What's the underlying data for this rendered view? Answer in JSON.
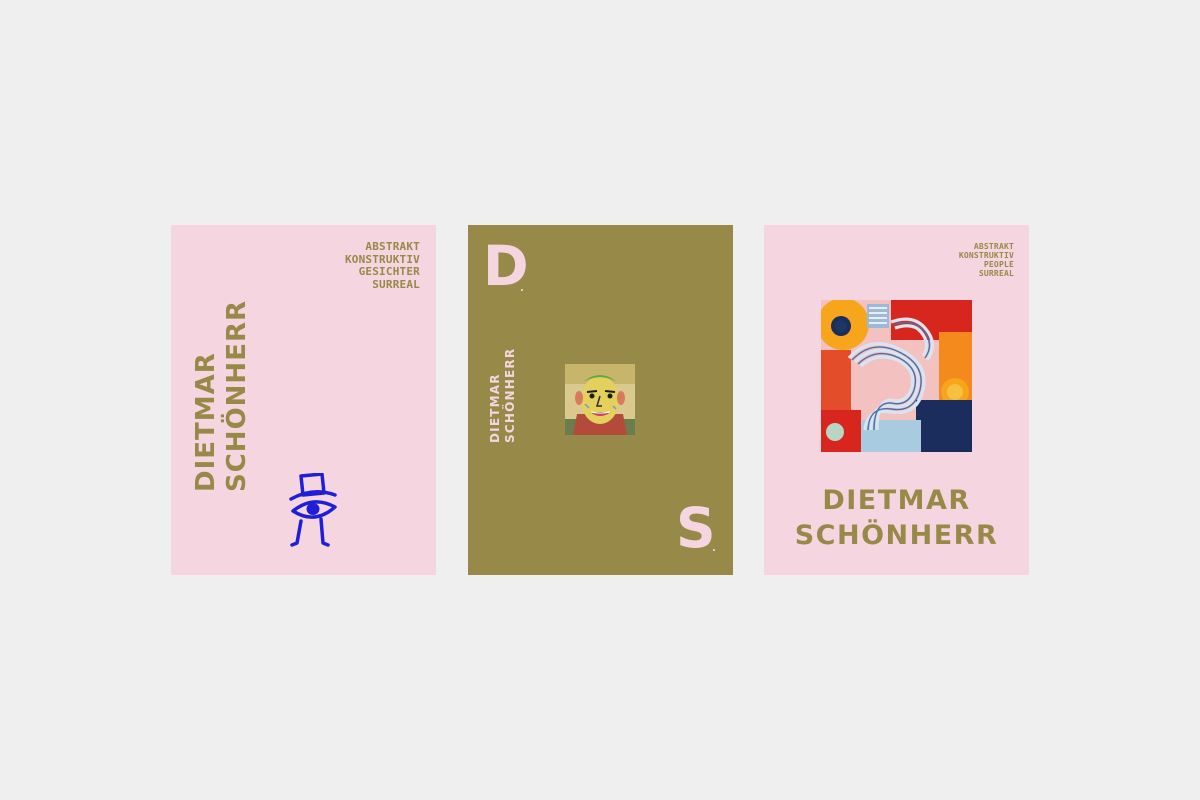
{
  "colors": {
    "background": "#efefef",
    "pink": "#f5d6e0",
    "olive": "#978947",
    "mascot_blue": "#1f1fd8"
  },
  "card1": {
    "tags": [
      "ABSTRAKT",
      "KONSTRUKTIV",
      "GESICHTER",
      "SURREAL"
    ],
    "first_name": "DIETMAR",
    "last_name": "SCHÖNHERR",
    "mascot_icon": "eye-top-hat-figure-icon"
  },
  "card2": {
    "letter_top": "D",
    "letter_bottom": "S",
    "dot": ".",
    "first_name": "DIETMAR",
    "last_name": "SCHÖNHERR",
    "image": "face-portrait-painting"
  },
  "card3": {
    "tags": [
      "ABSTRAKT",
      "KONSTRUKTIV",
      "PEOPLE",
      "SURREAL"
    ],
    "first_name": "DIETMAR",
    "last_name": "SCHÖNHERR",
    "image": "abstract-colorful-painting"
  }
}
